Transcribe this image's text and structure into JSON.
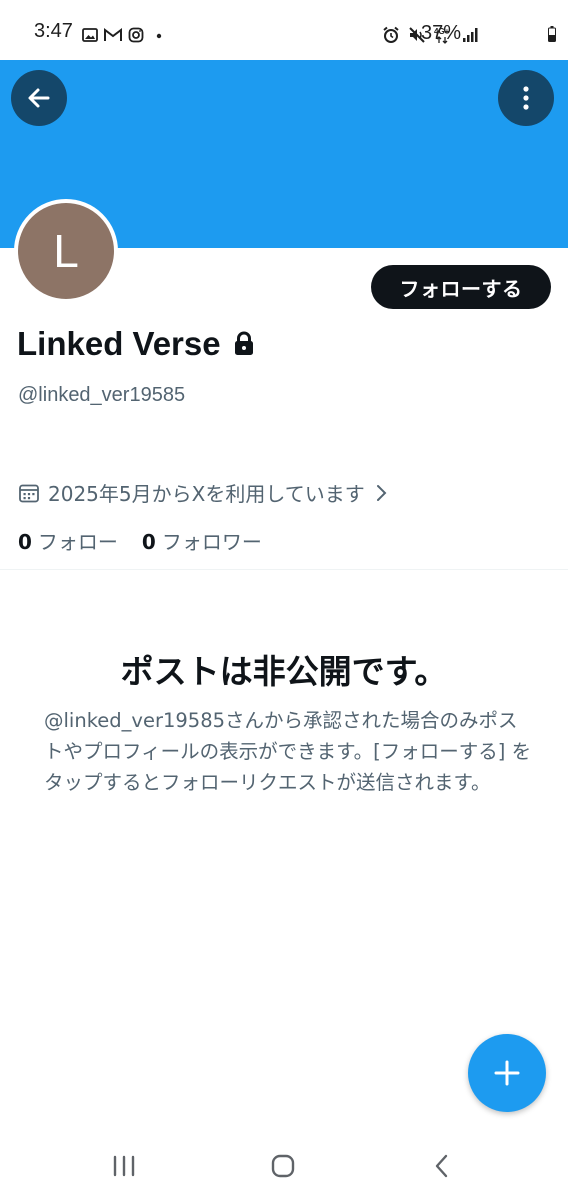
{
  "status_bar": {
    "time": "3:47",
    "battery": "37%",
    "network": "4G+"
  },
  "header": {
    "banner_color": "#1d9bf0",
    "back_icon": "arrow-left-icon",
    "more_icon": "more-vertical-icon"
  },
  "profile": {
    "avatar_letter": "L",
    "avatar_color": "#8d7466",
    "display_name": "Linked Verse",
    "protected_icon": "lock-icon",
    "handle": "@linked_ver19585",
    "follow_label": "フォローする",
    "joined": "2025年5月からXを利用しています",
    "following_count": "0",
    "following_label": "フォロー",
    "followers_count": "0",
    "followers_label": "フォロワー"
  },
  "private_notice": {
    "title": "ポストは非公開です。",
    "body": "@linked_ver19585さんから承認された場合のみポストやプロフィールの表示ができます。[フォローする] をタップするとフォローリクエストが送信されます。"
  },
  "fab": {
    "icon": "plus-icon",
    "color": "#1d9bf0"
  },
  "nav": {
    "recents_icon": "recents-icon",
    "home_icon": "home-icon",
    "back_icon": "nav-back-icon"
  }
}
